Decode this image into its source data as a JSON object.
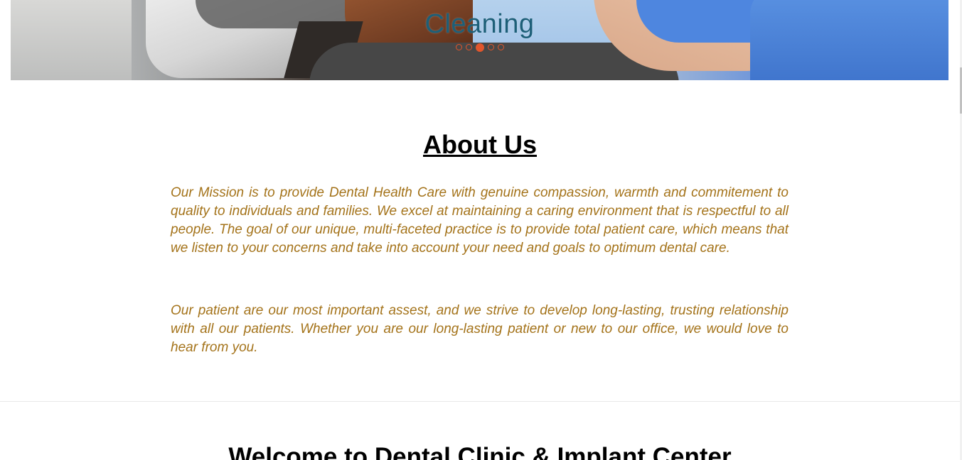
{
  "hero": {
    "caption": "Cleaning",
    "slide_count": 5,
    "active_slide_index": 2
  },
  "about": {
    "title": "About Us",
    "paragraph_1": "Our Mission is to provide Dental Health Care with genuine compassion, warmth and commitement to quality to individuals and families. We excel at maintaining a caring environment that is respectful to all people. The goal of our unique, multi-faceted practice is to provide total patient care, which means that we listen to your concerns and take into account your need and goals to optimum dental care.",
    "paragraph_2": "Our patient are our most important assest, and we strive to develop long-lasting, trusting relationship with all our patients. Whether you are our long-lasting patient or new to our office, we would love to hear from you."
  },
  "welcome": {
    "title": "Welcome to Dental Clinic & Implant Center"
  },
  "colors": {
    "caption": "#1d5f78",
    "accent_dots": "#e2562c",
    "about_text": "#a4731a",
    "heading": "#000000"
  }
}
